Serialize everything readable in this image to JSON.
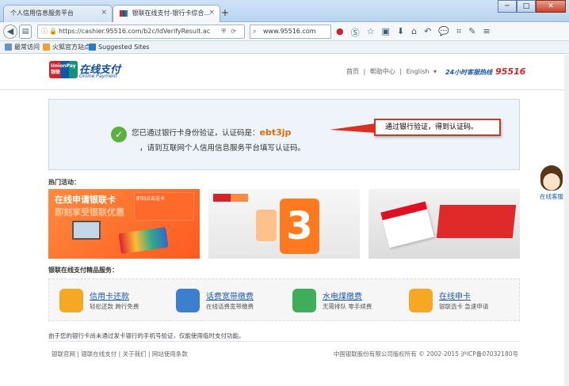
{
  "browser": {
    "tabs": [
      {
        "label": "个人信用信息服务平台"
      },
      {
        "label": "银联在线支付-银行卡综合..."
      }
    ],
    "new_tab": "+",
    "url": "https://cashier.95516.com/b2c/IdVerifyResult.ac",
    "search_value": "www.95516.com",
    "bookmarks": [
      "最常访问",
      "火狐官方站点",
      "Suggested Sites"
    ],
    "window_buttons": [
      "─",
      "□",
      "✕"
    ]
  },
  "header": {
    "logo_badge": "UnionPay 银联",
    "logo_title": "在线支付",
    "logo_sub": "Online Payment",
    "nav": [
      "首页",
      "|",
      "帮助中心",
      "|",
      "English",
      "▾"
    ],
    "hotline_label": "24小时客服热线",
    "hotline_number": "95516"
  },
  "notice": {
    "line1": "您已通过银行卡身份验证，认证码是：",
    "code": "ebt3jp",
    "line2": "，请到互联网个人信用信息服务平台填写认证码。",
    "callout": "通过银行验证，得到认证码。"
  },
  "hot": {
    "title": "热门活动：",
    "banner1_title": "在线申请银联卡",
    "banner1_sub": "即刻享受银联优惠",
    "banner1_promo": "即刻点击送卡"
  },
  "services": {
    "title": "银联在线支付精品服务：",
    "items": [
      {
        "name": "信用卡还款",
        "desc": "轻松还款 跨行免费",
        "color": "#f6a823"
      },
      {
        "name": "话费宽带缴费",
        "desc": "在线话费宽带缴费",
        "color": "#3b7fce"
      },
      {
        "name": "水电煤缴费",
        "desc": "无需排队 零手续费",
        "color": "#3fae5a"
      },
      {
        "name": "在线申卡",
        "desc": "银联选卡 急速申请",
        "color": "#f6a823"
      }
    ]
  },
  "footnote": "由于您的银行卡尚未通过发卡银行的手机号验证，仅能使用临时支付功能。",
  "footer": {
    "links": "银联官网 | 银联在线支付 | 关于我们 | 网站使用条款",
    "copyright": "中国银联股份有限公司版权所有 © 2002-2015 沪ICP备07032180号"
  },
  "customer_service": "在线客服"
}
